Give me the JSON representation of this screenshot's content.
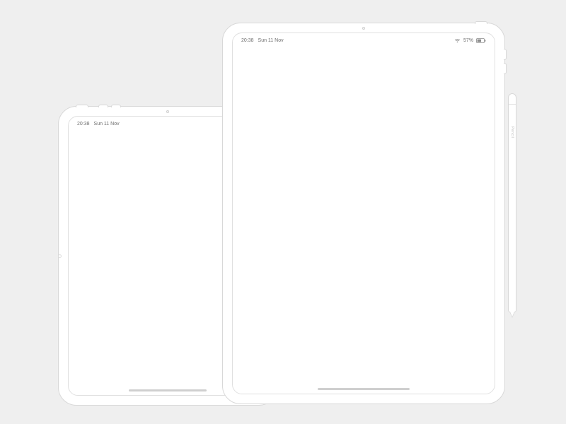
{
  "tablet_back": {
    "status": {
      "time": "20:38",
      "date": "Sun 11 Nov"
    }
  },
  "tablet_front": {
    "status": {
      "time": "20:38",
      "date": "Sun 11 Nov",
      "battery_percent": "57%"
    }
  },
  "pencil": {
    "brand_glyph": "",
    "label": "Pencil"
  }
}
